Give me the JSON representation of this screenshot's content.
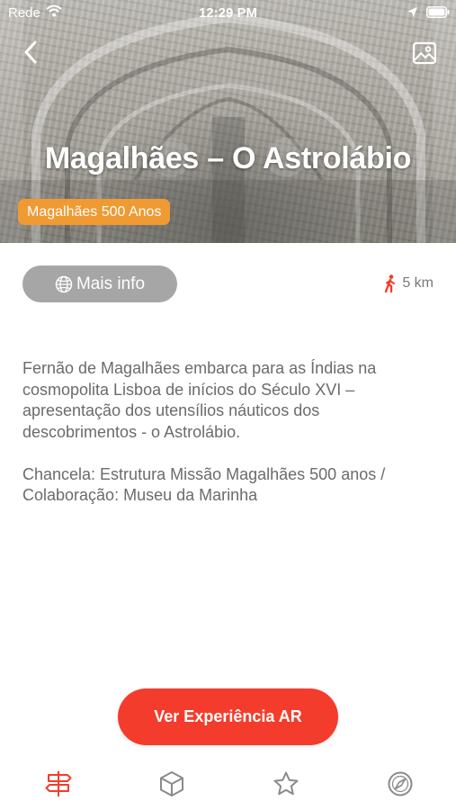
{
  "status_bar": {
    "carrier": "Rede",
    "time": "12:29 PM"
  },
  "hero": {
    "title": "Magalhães – O Astrolábio",
    "tag": "Magalhães 500 Anos"
  },
  "actions": {
    "info_label": "Mais info",
    "distance": "5 km"
  },
  "description": "Fernão de Magalhães embarca para as Índias na cosmopolita Lisboa de inícios do Século XVI – apresentação dos utensílios náuticos dos descobrimentos - o Astrolábio.\n\nChancela: Estrutura Missão Magalhães 500 anos / Colaboração:  Museu da Marinha",
  "cta_label": "Ver Experiência AR",
  "tab_bar": {
    "items": [
      {
        "icon": "signpost-icon",
        "active": true
      },
      {
        "icon": "cube-icon",
        "active": false
      },
      {
        "icon": "star-icon",
        "active": false
      },
      {
        "icon": "compass-icon",
        "active": false
      }
    ]
  },
  "colors": {
    "accent": "#f43c2c",
    "tag": "#ef9a33",
    "muted_button": "#a6a6a6",
    "body_text": "#6b6b6b",
    "tab_inactive": "#8a8a8a"
  }
}
